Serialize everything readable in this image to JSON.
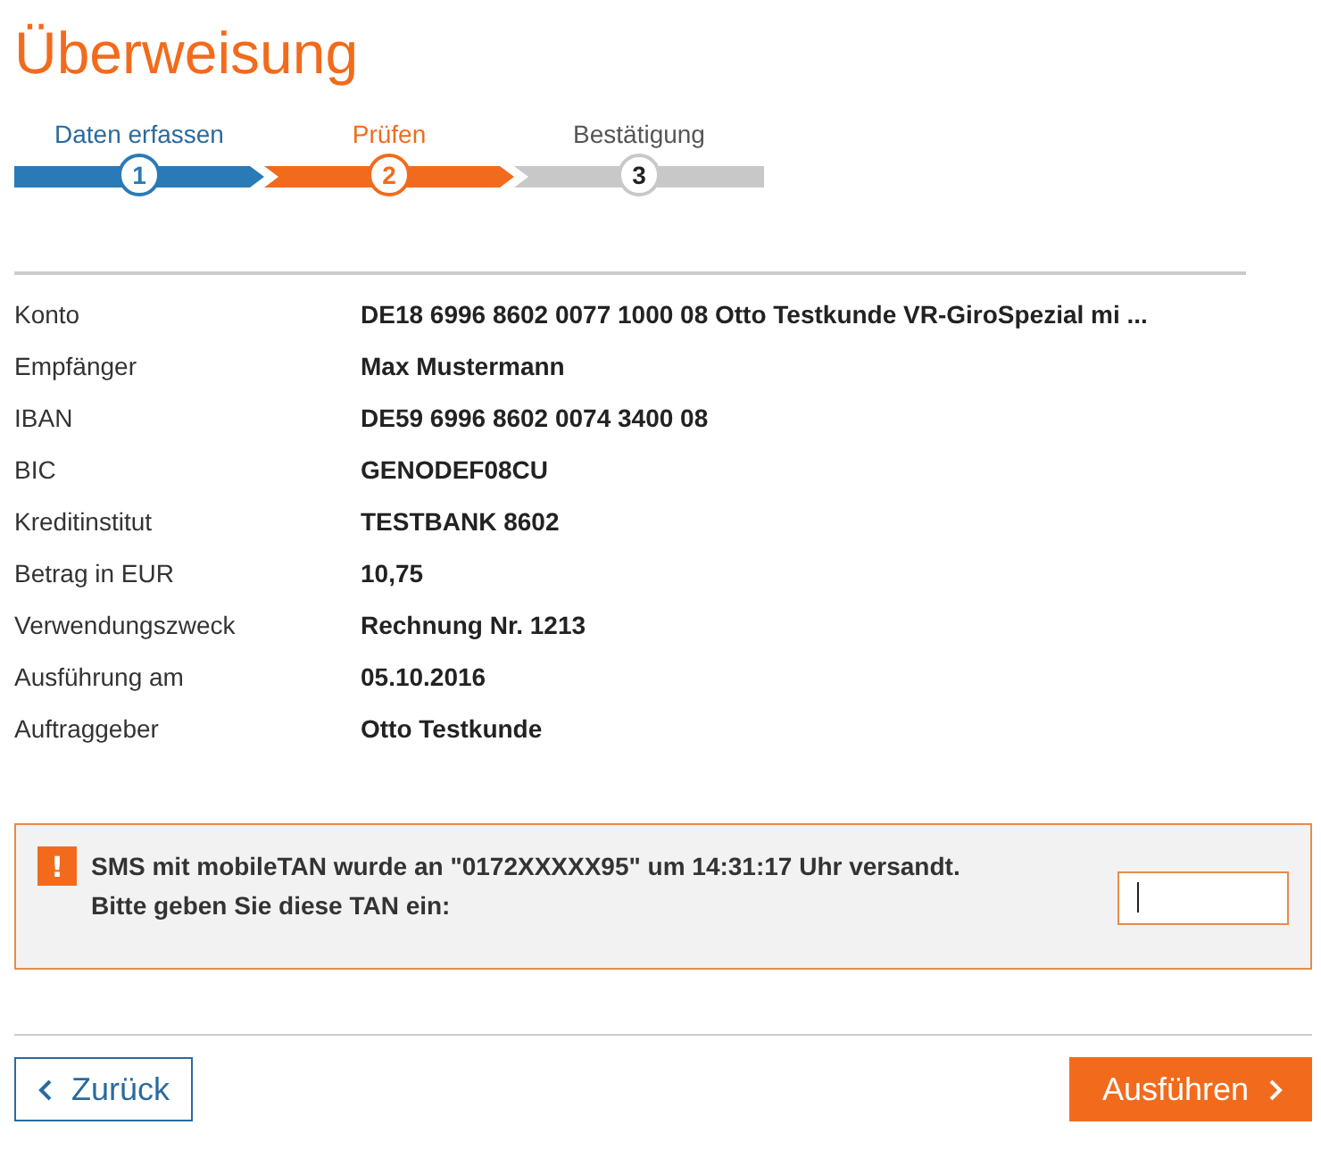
{
  "title": "Überweisung",
  "steps": [
    {
      "label": "Daten erfassen",
      "number": "1",
      "kind": "done"
    },
    {
      "label": "Prüfen",
      "number": "2",
      "kind": "current"
    },
    {
      "label": "Bestätigung",
      "number": "3",
      "kind": "pending"
    }
  ],
  "details": [
    {
      "label": "Konto",
      "value": "DE18 6996 8602 0077 1000 08 Otto Testkunde VR-GiroSpezial mi ..."
    },
    {
      "label": "Empfänger",
      "value": "Max Mustermann"
    },
    {
      "label": "IBAN",
      "value": "DE59 6996 8602 0074 3400 08"
    },
    {
      "label": "BIC",
      "value": "GENODEF08CU"
    },
    {
      "label": "Kreditinstitut",
      "value": "TESTBANK 8602"
    },
    {
      "label": "Betrag in EUR",
      "value": "10,75"
    },
    {
      "label": "Verwendungszweck",
      "value": "Rechnung Nr. 1213"
    },
    {
      "label": "Ausführung am",
      "value": "05.10.2016"
    },
    {
      "label": "Auftraggeber",
      "value": "Otto Testkunde"
    }
  ],
  "tan_notice": {
    "icon": "!",
    "message": "SMS mit mobileTAN wurde an \"0172XXXXX95\" um 14:31:17 Uhr versandt.",
    "prompt": "Bitte geben Sie diese TAN ein:"
  },
  "buttons": {
    "back": "Zurück",
    "submit": "Ausführen"
  }
}
